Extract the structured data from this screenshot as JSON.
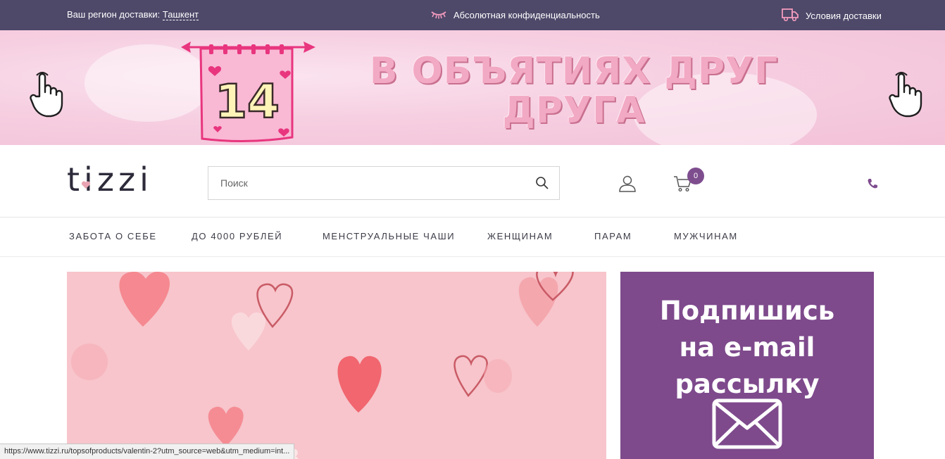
{
  "topbar": {
    "region_label": "Ваш регион доставки:",
    "region_city": "Ташкент",
    "privacy_text": "Абсолютная конфиденциальность",
    "delivery_text": "Условия доставки"
  },
  "banner": {
    "calendar_number": "14",
    "headline_line1": "В ОБЪЯТИЯХ ДРУГ",
    "headline_line2": "ДРУГА"
  },
  "header": {
    "logo_text": "tizzi",
    "search_placeholder": "Поиск",
    "cart_count": "0"
  },
  "nav": {
    "items": [
      {
        "label": "ЗАБОТА О СЕБЕ"
      },
      {
        "label": "ДО 4000 РУБЛЕЙ"
      },
      {
        "label": "МЕНСТРУАЛЬНЫЕ ЧАШИ"
      },
      {
        "label": "ЖЕНЩИНАМ"
      },
      {
        "label": "ПАРАМ"
      },
      {
        "label": "МУЖЧИНАМ"
      }
    ]
  },
  "promo": {
    "line1": "Подпишись",
    "line2": "на e-mail",
    "line3": "рассылку"
  },
  "hero": {
    "partial_text": "… … ия в"
  },
  "statusbar": {
    "url": "https://www.tizzi.ru/topsofproducts/valentin-2?utm_source=web&utm_medium=int..."
  },
  "colors": {
    "topbar_bg": "#4e4869",
    "accent": "#7e4d8e",
    "banner_pink": "#f6cfe1",
    "hero_bg": "#f7c5cb"
  }
}
